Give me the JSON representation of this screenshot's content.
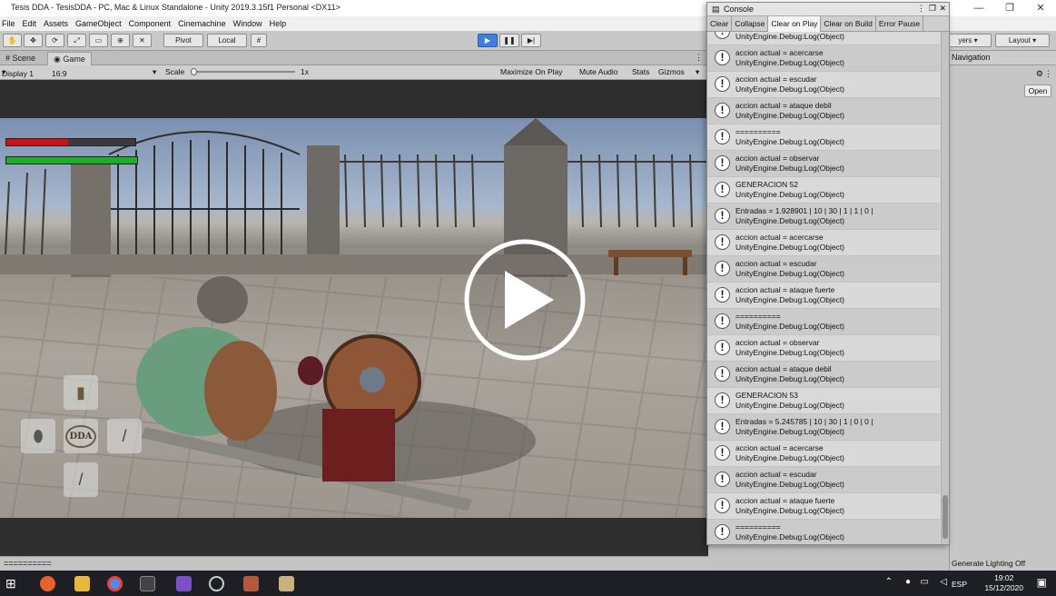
{
  "window": {
    "title": "Tesis DDA - TesisDDA - PC, Mac & Linux Standalone - Unity 2019.3.15f1 Personal <DX11>",
    "controls": [
      "—",
      "❐",
      "✕"
    ]
  },
  "menu": [
    "File",
    "Edit",
    "Assets",
    "GameObject",
    "Component",
    "Cinemachine",
    "Window",
    "Help"
  ],
  "toolbar": {
    "pivot_label": "Pivot",
    "local_label": "Local",
    "layers_label": "yers",
    "layout_label": "Layout"
  },
  "tabs": {
    "scene": "Scene",
    "game": "Game"
  },
  "game_bar": {
    "display": "Display 1",
    "aspect": "16:9",
    "scale_label": "Scale",
    "scale_value": "1x",
    "maximize": "Maximize On Play",
    "mute": "Mute Audio",
    "stats": "Stats",
    "gizmos": "Gizmos"
  },
  "hud": {
    "dda_label": "DDA",
    "enemy_health": 0.48,
    "player_health": 1.0
  },
  "bottom_status": "==========",
  "right_panel": {
    "tab": "Navigation",
    "open_label": "Open",
    "status": "Generate Lighting Off"
  },
  "console": {
    "title": "Console",
    "buttons": [
      "Clear",
      "Collapse",
      "Clear on Play",
      "Clear on Build",
      "Error Pause"
    ],
    "active_button": "Clear on Play",
    "logs": [
      {
        "msg": "",
        "src": "UnityEngine.Debug:Log(Object)"
      },
      {
        "msg": "accion actual = acercarse",
        "src": "UnityEngine.Debug:Log(Object)"
      },
      {
        "msg": "accion actual = escudar",
        "src": "UnityEngine.Debug:Log(Object)"
      },
      {
        "msg": "accion actual = ataque debil",
        "src": "UnityEngine.Debug:Log(Object)"
      },
      {
        "msg": "==========",
        "src": "UnityEngine.Debug:Log(Object)"
      },
      {
        "msg": "accion actual = observar",
        "src": "UnityEngine.Debug:Log(Object)"
      },
      {
        "msg": "GENERACION 52",
        "src": "UnityEngine.Debug:Log(Object)"
      },
      {
        "msg": "Entradas = 1.928901 | 10 | 30 | 1 | 1 | 0 |",
        "src": "UnityEngine.Debug:Log(Object)"
      },
      {
        "msg": "accion actual = acercarse",
        "src": "UnityEngine.Debug:Log(Object)"
      },
      {
        "msg": "accion actual = escudar",
        "src": "UnityEngine.Debug:Log(Object)"
      },
      {
        "msg": "accion actual = ataque fuerte",
        "src": "UnityEngine.Debug:Log(Object)"
      },
      {
        "msg": "==========",
        "src": "UnityEngine.Debug:Log(Object)"
      },
      {
        "msg": "accion actual = observar",
        "src": "UnityEngine.Debug:Log(Object)"
      },
      {
        "msg": "accion actual = ataque debil",
        "src": "UnityEngine.Debug:Log(Object)"
      },
      {
        "msg": "GENERACION 53",
        "src": "UnityEngine.Debug:Log(Object)"
      },
      {
        "msg": "Entradas = 5.245785 | 10 | 30 | 1 | 0 | 0 |",
        "src": "UnityEngine.Debug:Log(Object)"
      },
      {
        "msg": "accion actual = acercarse",
        "src": "UnityEngine.Debug:Log(Object)"
      },
      {
        "msg": "accion actual = escudar",
        "src": "UnityEngine.Debug:Log(Object)"
      },
      {
        "msg": "accion actual = ataque fuerte",
        "src": "UnityEngine.Debug:Log(Object)"
      },
      {
        "msg": "==========",
        "src": "UnityEngine.Debug:Log(Object)"
      }
    ]
  },
  "taskbar": {
    "language": "ESP",
    "time": "19:02",
    "date": "15/12/2020"
  },
  "colors": {
    "play_blue": "#3d7fd9",
    "enemy_health": "#c81414",
    "player_health": "#1fae2a"
  }
}
